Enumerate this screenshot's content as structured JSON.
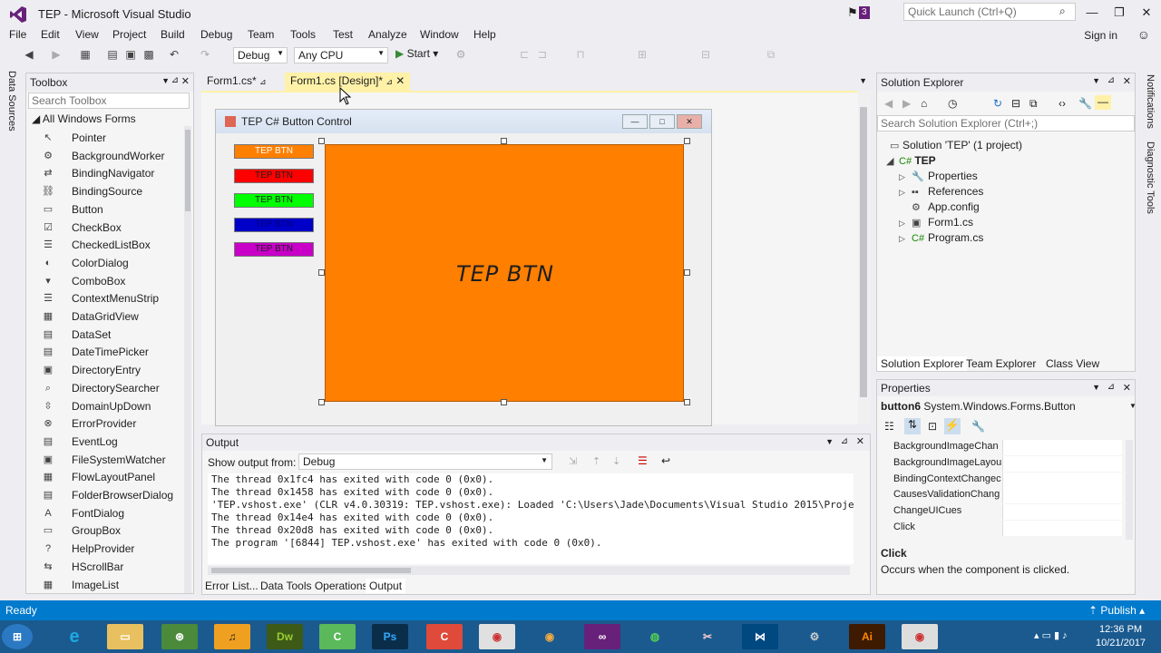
{
  "window": {
    "title": "TEP - Microsoft Visual Studio",
    "notif_count": "3",
    "quick_launch_placeholder": "Quick Launch (Ctrl+Q)",
    "sign_in": "Sign in"
  },
  "menu": [
    "File",
    "Edit",
    "View",
    "Project",
    "Build",
    "Debug",
    "Team",
    "Tools",
    "Test",
    "Analyze",
    "Window",
    "Help"
  ],
  "toolbar": {
    "config": "Debug",
    "platform": "Any CPU",
    "start": "Start"
  },
  "side_tabs": {
    "left": "Data Sources",
    "right1": "Notifications",
    "right2": "Diagnostic Tools"
  },
  "toolbox": {
    "title": "Toolbox",
    "search_placeholder": "Search Toolbox",
    "group": "All Windows Forms",
    "items": [
      "Pointer",
      "BackgroundWorker",
      "BindingNavigator",
      "BindingSource",
      "Button",
      "CheckBox",
      "CheckedListBox",
      "ColorDialog",
      "ComboBox",
      "ContextMenuStrip",
      "DataGridView",
      "DataSet",
      "DateTimePicker",
      "DirectoryEntry",
      "DirectorySearcher",
      "DomainUpDown",
      "ErrorProvider",
      "EventLog",
      "FileSystemWatcher",
      "FlowLayoutPanel",
      "FolderBrowserDialog",
      "FontDialog",
      "GroupBox",
      "HelpProvider",
      "HScrollBar",
      "ImageList"
    ]
  },
  "doc_tabs": {
    "tab1": "Form1.cs*",
    "tab2": "Form1.cs [Design]*"
  },
  "form": {
    "title": "TEP C# Button Control",
    "small_buttons": [
      {
        "label": "TEP BTN",
        "color": "#ff7f00"
      },
      {
        "label": "TEP BTN",
        "color": "#ff0000"
      },
      {
        "label": "TEP BTN",
        "color": "#00ff00"
      },
      {
        "label": "TEP BTN",
        "color": "#0000c8"
      },
      {
        "label": "TEP BTN",
        "color": "#c800c8"
      }
    ],
    "big_button_label": "TEP BTN",
    "big_button_color": "#ff7f00"
  },
  "output": {
    "title": "Output",
    "show_from_label": "Show output from:",
    "show_from_value": "Debug",
    "lines": [
      "The thread 0x1fc4 has exited with code 0 (0x0).",
      "The thread 0x1458 has exited with code 0 (0x0).",
      "'TEP.vshost.exe' (CLR v4.0.30319: TEP.vshost.exe): Loaded 'C:\\Users\\Jade\\Documents\\Visual Studio 2015\\Projec",
      "The thread 0x14e4 has exited with code 0 (0x0).",
      "The thread 0x20d8 has exited with code 0 (0x0).",
      "The program '[6844] TEP.vshost.exe' has exited with code 0 (0x0)."
    ]
  },
  "bottom_tabs": {
    "errors": "Error List...",
    "data_tools": "Data Tools Operations",
    "output": "Output"
  },
  "solution_explorer": {
    "title": "Solution Explorer",
    "search_placeholder": "Search Solution Explorer (Ctrl+;)",
    "solution": "Solution 'TEP' (1 project)",
    "project": "TEP",
    "items": [
      "Properties",
      "References",
      "App.config",
      "Form1.cs",
      "Program.cs"
    ],
    "tabs": [
      "Solution Explorer",
      "Team Explorer",
      "Class View"
    ]
  },
  "properties": {
    "title": "Properties",
    "object": "button6",
    "object_type": "System.Windows.Forms.Button",
    "rows": [
      "BackgroundImageChan",
      "BackgroundImageLayou",
      "BindingContextChangec",
      "CausesValidationChang",
      "ChangeUICues",
      "Click"
    ],
    "desc_title": "Click",
    "desc_text": "Occurs when the component is clicked."
  },
  "status": {
    "text": "Ready",
    "publish": "Publish"
  },
  "taskbar": {
    "time": "12:36 PM",
    "date": "10/21/2017"
  }
}
